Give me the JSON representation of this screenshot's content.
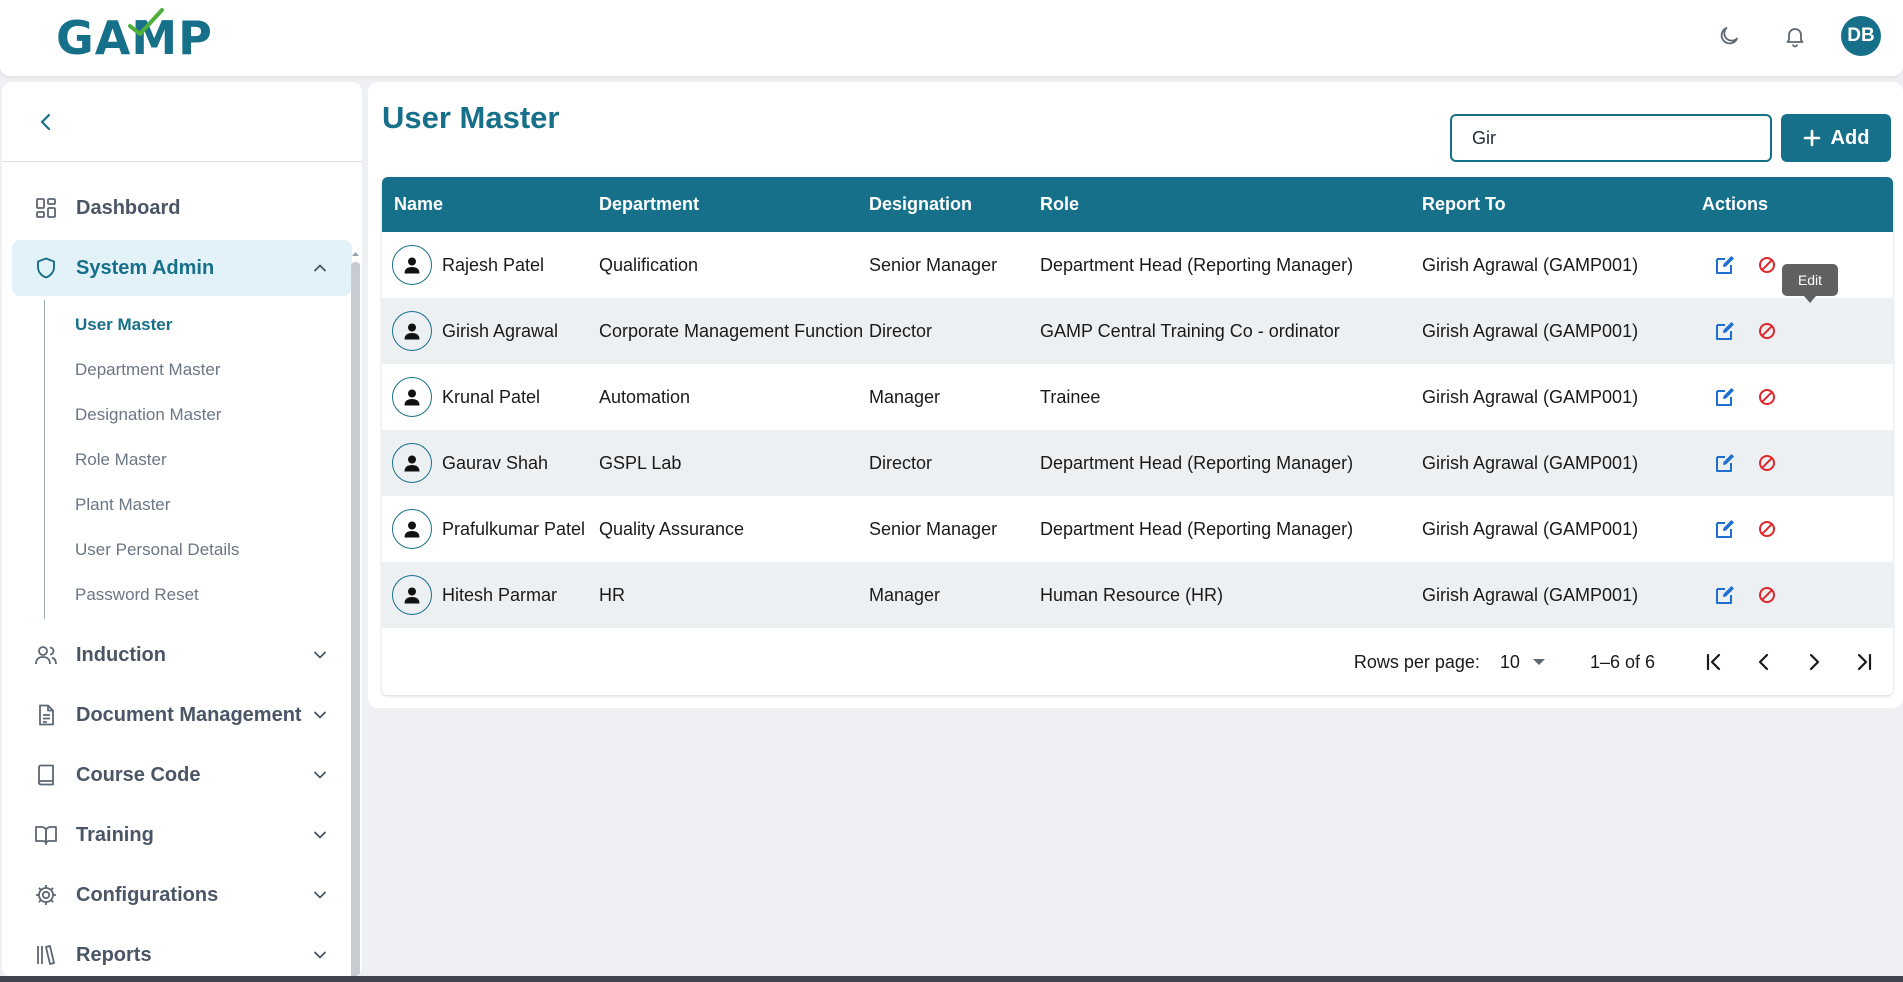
{
  "header": {
    "logo_text": "GAMP",
    "user_initials": "DB",
    "icons": [
      "moon-icon",
      "bell-icon"
    ]
  },
  "sidebar": {
    "items": [
      {
        "label": "Dashboard",
        "icon": "dashboard-icon"
      },
      {
        "label": "System Admin",
        "icon": "shield-icon",
        "expanded": true,
        "children": [
          "User Master",
          "Department Master",
          "Designation Master",
          "Role Master",
          "Plant Master",
          "User Personal Details",
          "Password Reset"
        ]
      },
      {
        "label": "Induction",
        "icon": "users-icon"
      },
      {
        "label": "Document Management",
        "icon": "document-icon"
      },
      {
        "label": "Course Code",
        "icon": "book-icon"
      },
      {
        "label": "Training",
        "icon": "open-book-icon"
      },
      {
        "label": "Configurations",
        "icon": "gear-icon"
      },
      {
        "label": "Reports",
        "icon": "library-icon"
      }
    ]
  },
  "main": {
    "title": "User Master",
    "search_value": "Gir",
    "add_label": "Add",
    "tooltip": "Edit",
    "columns": [
      "Name",
      "Department",
      "Designation",
      "Role",
      "Report To",
      "Actions"
    ],
    "rows": [
      {
        "name": "Rajesh Patel",
        "department": "Qualification",
        "designation": "Senior Manager",
        "role": "Department Head (Reporting Manager)",
        "report_to": "Girish Agrawal (GAMP001)"
      },
      {
        "name": "Girish Agrawal",
        "department": "Corporate Management Function",
        "designation": "Director",
        "role": "GAMP Central Training Co - ordinator",
        "report_to": "Girish Agrawal (GAMP001)"
      },
      {
        "name": "Krunal Patel",
        "department": "Automation",
        "designation": "Manager",
        "role": "Trainee",
        "report_to": "Girish Agrawal (GAMP001)"
      },
      {
        "name": "Gaurav Shah",
        "department": "GSPL Lab",
        "designation": "Director",
        "role": "Department Head (Reporting Manager)",
        "report_to": "Girish Agrawal (GAMP001)"
      },
      {
        "name": "Prafulkumar Patel",
        "department": "Quality Assurance",
        "designation": "Senior Manager",
        "role": "Department Head (Reporting Manager)",
        "report_to": "Girish Agrawal (GAMP001)"
      },
      {
        "name": "Hitesh Parmar",
        "department": "HR",
        "designation": "Manager",
        "role": "Human Resource (HR)",
        "report_to": "Girish Agrawal (GAMP001)"
      }
    ],
    "pagination": {
      "rows_per_page_label": "Rows per page:",
      "rows_per_page": "10",
      "range": "1–6 of 6"
    }
  },
  "colors": {
    "brand": "#17708a",
    "edit": "#1f6fd1",
    "delete": "#e0262b",
    "active_bg": "#e3f1f8"
  }
}
